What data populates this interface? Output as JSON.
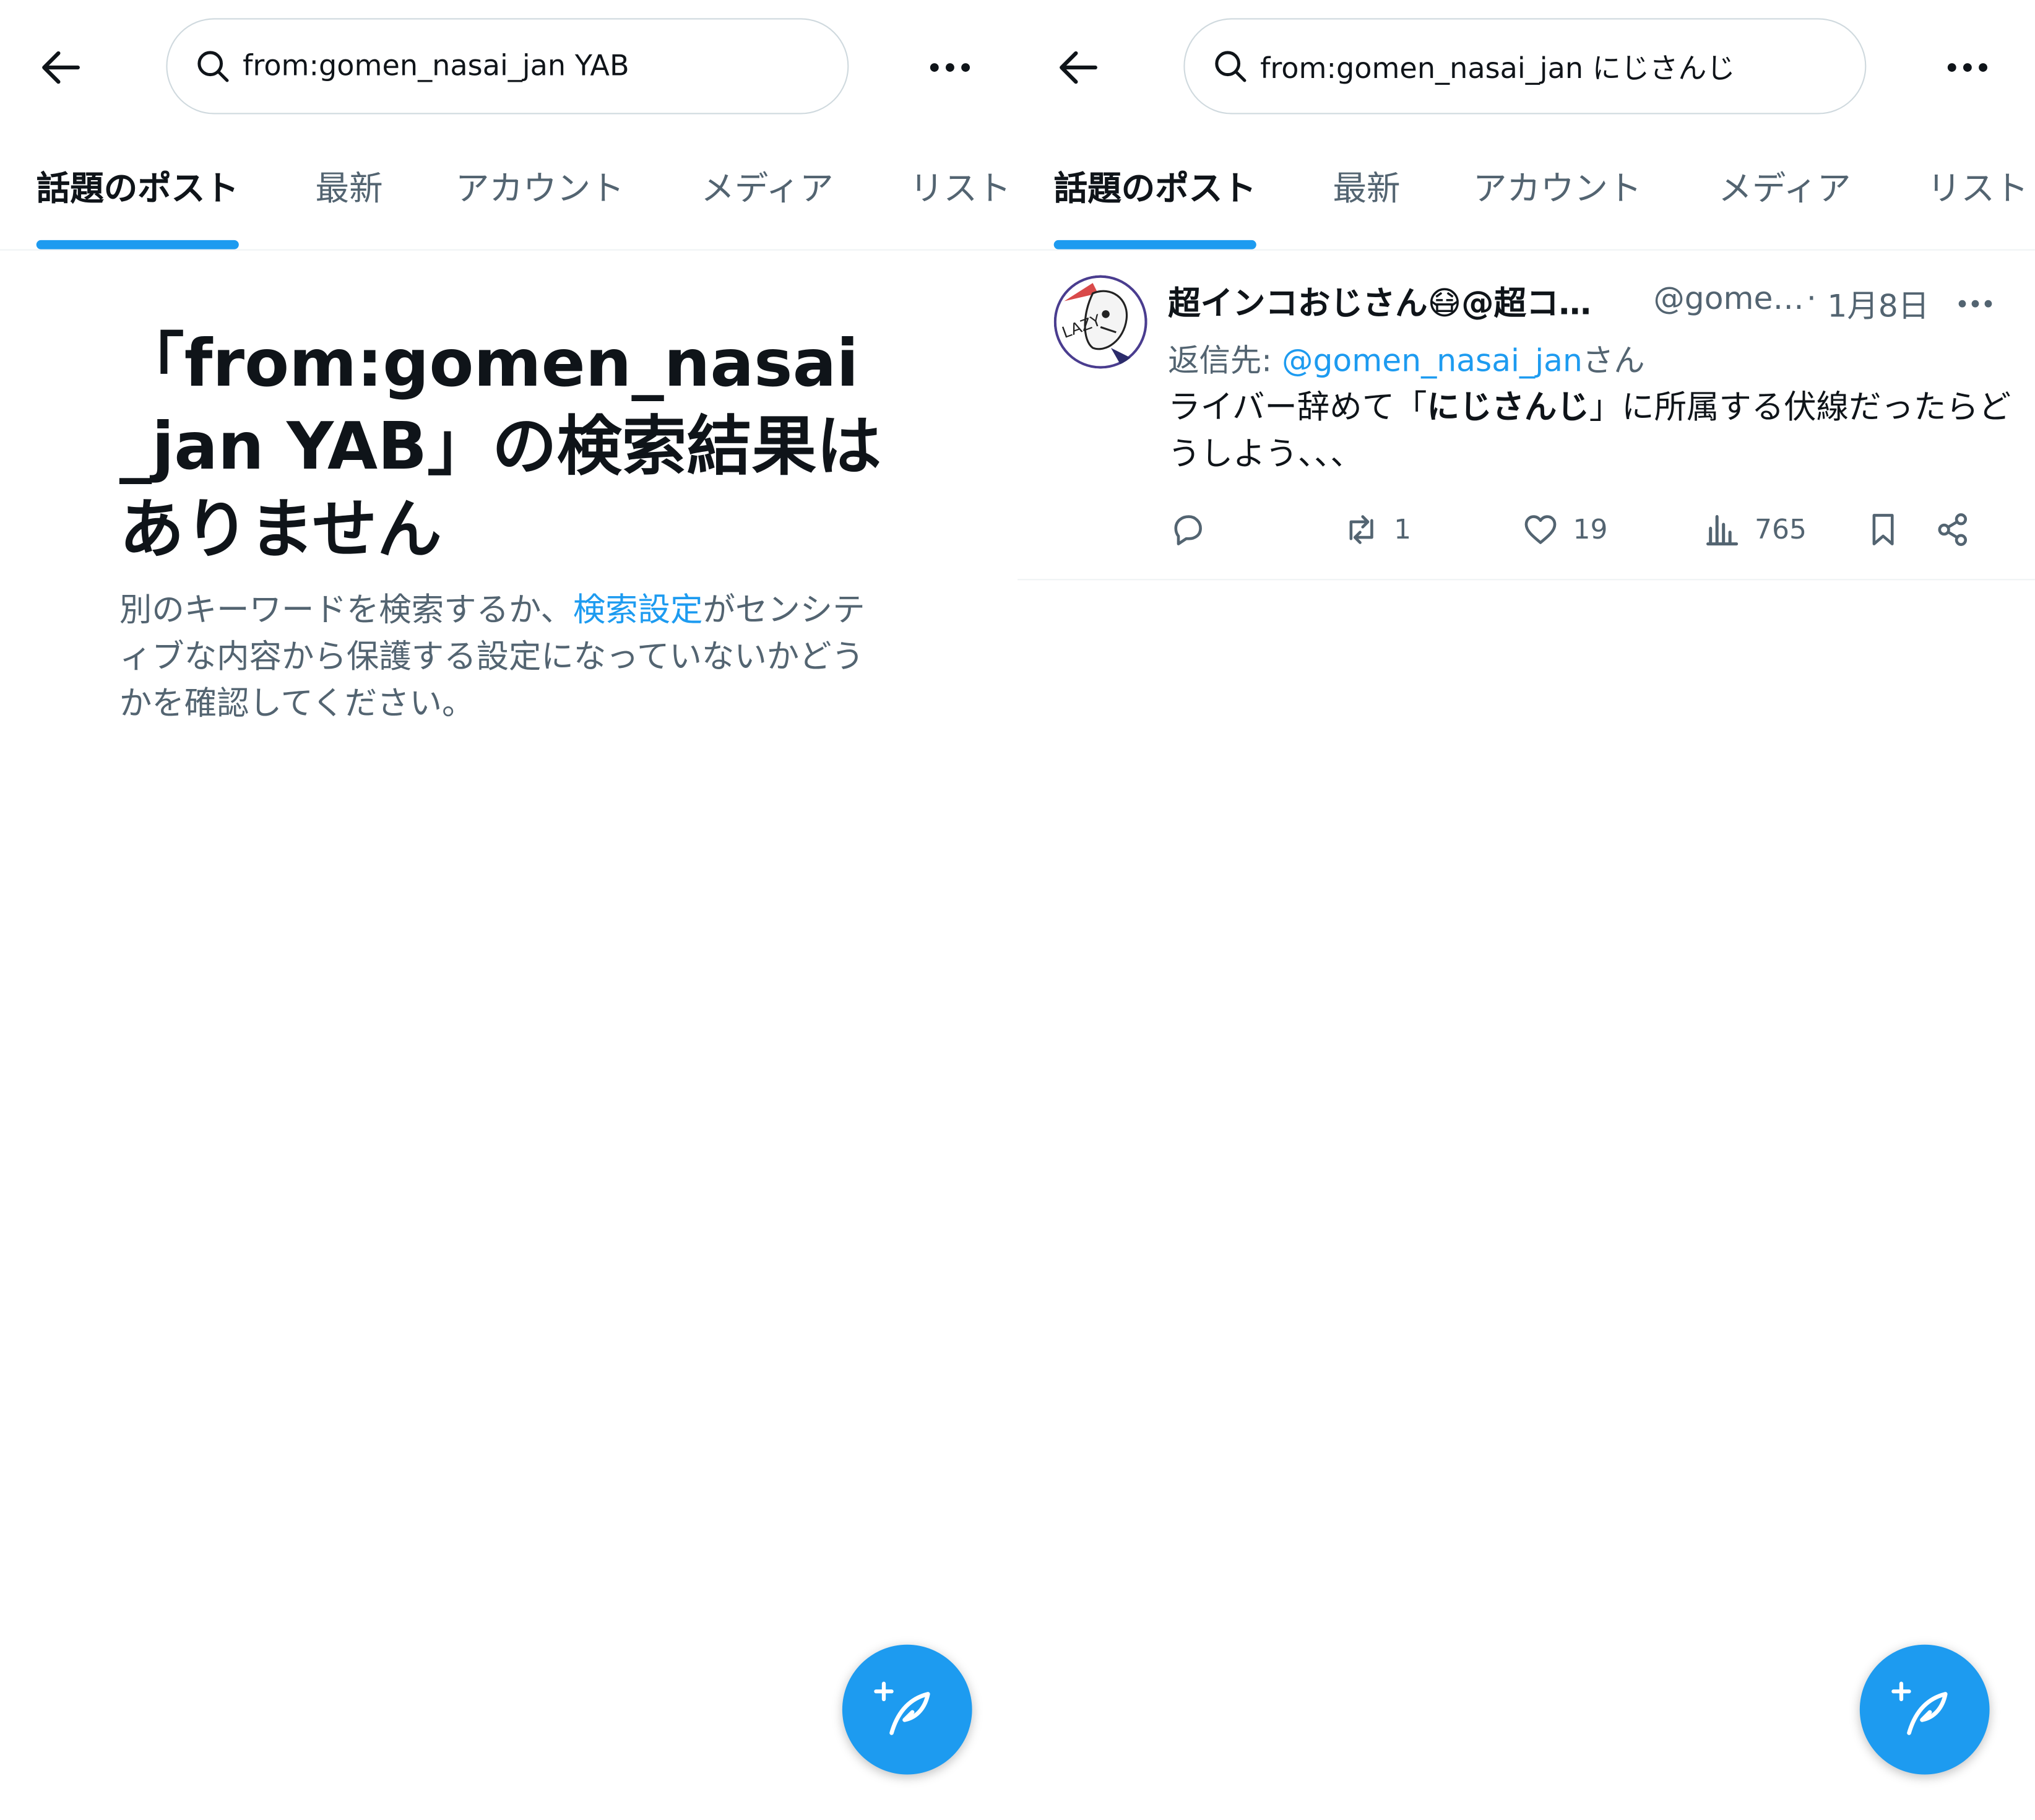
{
  "left": {
    "search_query": "from:gomen_nasai_jan YAB",
    "tabs": [
      "話題のポスト",
      "最新",
      "アカウント",
      "メディア",
      "リスト"
    ],
    "empty_title": "「from:gomen_nasai_jan YAB」の検索結果はありません",
    "empty_desc_before": "別のキーワードを検索するか、",
    "empty_desc_link": "検索設定",
    "empty_desc_after": "がセンシティブな内容から保護する設定になっていないかどうかを確認してください。"
  },
  "right": {
    "search_query": "from:gomen_nasai_jan にじさんじ",
    "tabs": [
      "話題のポスト",
      "最新",
      "アカウント",
      "メディア",
      "リスト"
    ],
    "tweet": {
      "display_name": "超インコおじさん😷@超コ…",
      "handle": "@gome…",
      "dot": "·",
      "date": "1月8日",
      "reply_prefix": "返信先: ",
      "reply_to": "@gomen_nasai_jan",
      "reply_suffix": "さん",
      "text_before": "ライバー辞めて「",
      "text_bold": "にじさんじ",
      "text_after": "」に所属する伏線だったらどうしよう、、、",
      "retweets": "1",
      "likes": "19",
      "views": "765"
    }
  },
  "colors": {
    "accent": "#1d9bf0",
    "text": "#0f1419",
    "secondary": "#536471",
    "border": "#cfd9de"
  },
  "icons": [
    "back-arrow-icon",
    "search-icon",
    "more-icon",
    "compose-icon",
    "reply-icon",
    "retweet-icon",
    "like-icon",
    "views-icon",
    "bookmark-icon",
    "share-icon"
  ]
}
